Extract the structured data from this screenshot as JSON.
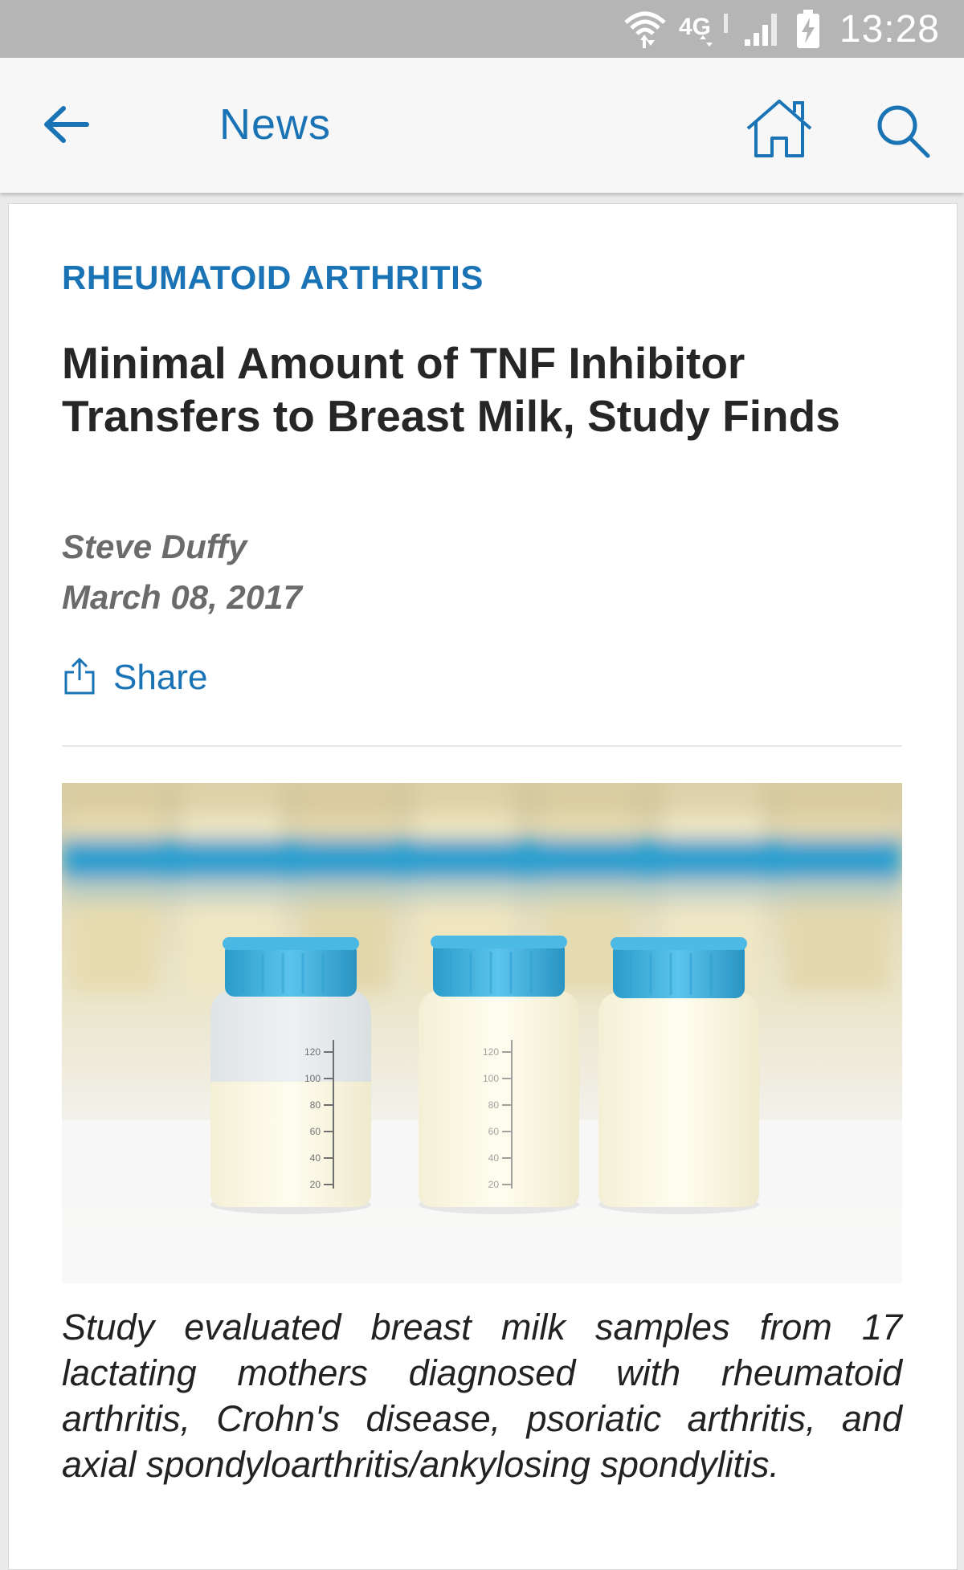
{
  "status_bar": {
    "network": "4G",
    "time": "13:28"
  },
  "app_bar": {
    "title": "News",
    "accent_color": "#1a73b5"
  },
  "article": {
    "category": "RHEUMATOID ARTHRITIS",
    "headline": "Minimal Amount of TNF Inhibitor Transfers to Breast Milk, Study Finds",
    "author": "Steve Duffy",
    "date": "March 08, 2017",
    "share_label": "Share",
    "image": {
      "bottle_scale_labels": [
        "120",
        "100",
        "80",
        "60",
        "40",
        "20"
      ]
    },
    "caption": "Study evaluated breast milk samples from 17 lactating mothers diagnosed with rheumatoid arthritis, Crohn's disease, psoriatic arthritis, and axial spondyloarthritis/ankylosing spondylitis."
  }
}
